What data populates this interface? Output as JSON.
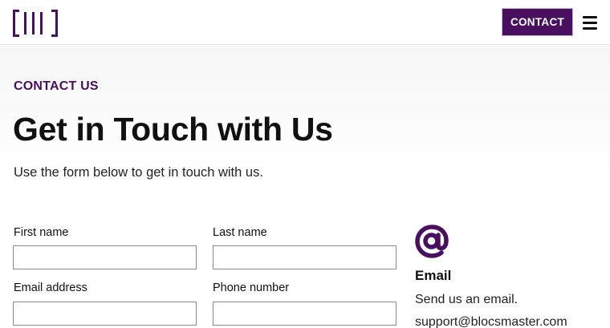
{
  "nav": {
    "contact_label": "CONTACT",
    "logo_icon": "barcode-logo-icon",
    "menu_icon": "hamburger-menu-icon"
  },
  "hero": {
    "eyebrow": "CONTACT US",
    "title": "Get in Touch with Us",
    "subtitle": "Use the form below to get in touch with us."
  },
  "form": {
    "first_name_label": "First name",
    "first_name_value": "",
    "last_name_label": "Last name",
    "last_name_value": "",
    "email_label": "Email address",
    "email_value": "",
    "phone_label": "Phone number",
    "phone_value": ""
  },
  "info": {
    "icon": "at-sign-icon",
    "heading": "Email",
    "text": "Send us an email.",
    "address": "support@blocsmaster.com"
  },
  "colors": {
    "brand": "#4a1060",
    "text": "#111111",
    "border": "#8a8a8a"
  }
}
